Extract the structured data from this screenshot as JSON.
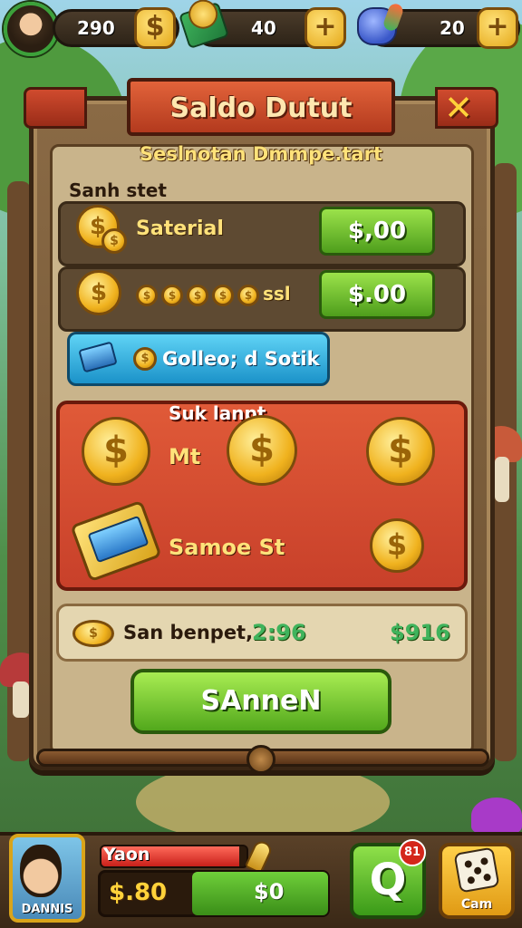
{
  "top_bar": {
    "coins": "290",
    "cash": "40",
    "gems": "20"
  },
  "dialog": {
    "title": "Saldo Dutut",
    "close_icon": "✕",
    "subtitle": "Seslnotan Dmmpe.tart",
    "section_heading": "Sanh stet",
    "rows": [
      {
        "label": "Saterial",
        "button": "$,00"
      },
      {
        "label": "ssl",
        "button": "$.00"
      }
    ],
    "collect_button": "Golleo; d Sotik",
    "red_panel": {
      "heading": "Suk lanpt",
      "label_1": "Mt",
      "label_2": "Samoe St"
    },
    "summary": {
      "label": "San benpet,",
      "time": "2:96",
      "total": "$916"
    },
    "main_button": "SAnneN"
  },
  "hud": {
    "portrait_name": "DANNIS",
    "player_name": "Yaon",
    "health_fraction": 0.95,
    "money_left": "$.80",
    "money_right": "$0",
    "badge": "81",
    "dice_label": "Cam"
  },
  "icons": {
    "coin_symbol": "$",
    "plus_symbol": "+",
    "search_symbol": "Q"
  },
  "colors": {
    "accent_green": "#3fb35c",
    "banner_red": "#c8402a",
    "gold": "#f0b21e",
    "blue_button": "#1b92c9"
  }
}
